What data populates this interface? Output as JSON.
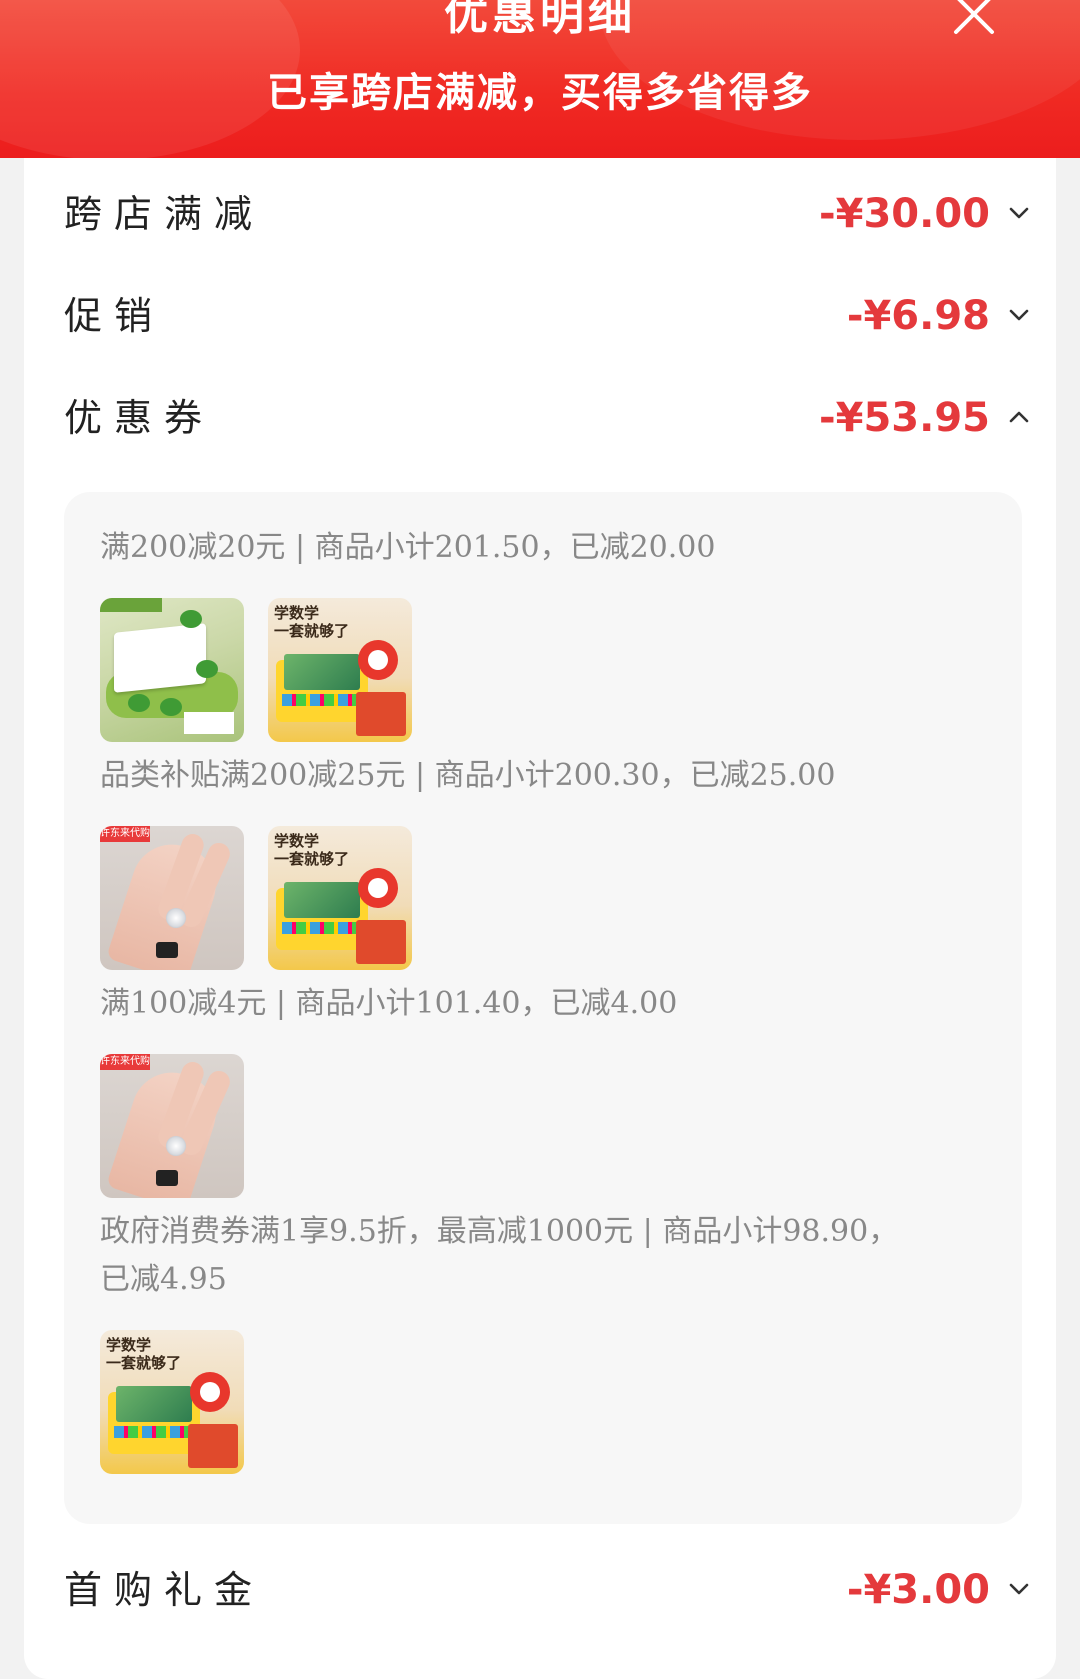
{
  "header": {
    "title": "优惠明细",
    "subtitle": "已享跨店满减，买得多省得多",
    "close_icon": "close-icon",
    "background_color": "#f02a23"
  },
  "rows": [
    {
      "label": "跨店满减",
      "amount": "-¥30.00",
      "chevron": "chevron-down-icon"
    },
    {
      "label": "促销",
      "amount": "-¥6.98",
      "chevron": "chevron-down-icon"
    },
    {
      "label": "优惠券",
      "amount": "-¥53.95",
      "chevron": "chevron-up-icon"
    },
    {
      "label": "首购礼金",
      "amount": "-¥3.00",
      "chevron": "chevron-down-icon"
    }
  ],
  "amount_color": "#e4393c",
  "coupon_details": [
    {
      "text": "满200减20元 | 商品小计201.50，已减20.00",
      "thumbnails": [
        "toy-product-thumbnail",
        "math-game-product-thumbnail"
      ]
    },
    {
      "text": "品类补贴满200减25元 | 商品小计200.30，已减25.00",
      "thumbnails": [
        "ring-product-thumbnail",
        "math-game-product-thumbnail"
      ]
    },
    {
      "text": "满100减4元 | 商品小计101.40，已减4.00",
      "thumbnails": [
        "ring-product-thumbnail"
      ]
    },
    {
      "text_line1": "政府消费券满1享9.5折，最高减1000元 | 商品小计98.90，",
      "text_line2": "已减4.95",
      "thumbnails": [
        "math-game-product-thumbnail"
      ]
    }
  ],
  "thumb_text": {
    "math_line1": "学数学",
    "math_line2": "一套就够了",
    "ring_tag": "许东来代购"
  }
}
